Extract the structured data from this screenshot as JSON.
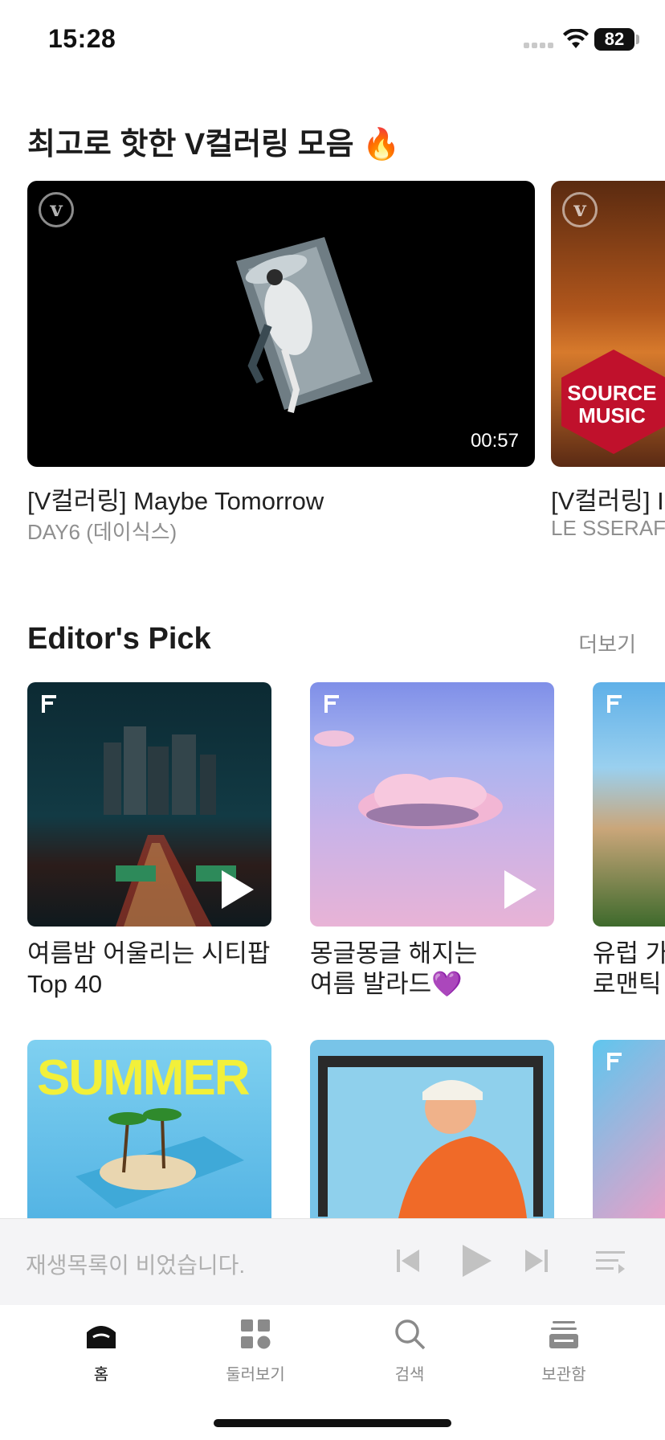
{
  "status_bar": {
    "time": "15:28",
    "battery": "82"
  },
  "vcoloring": {
    "title": "최고로 핫한 V컬러링 모음 🔥",
    "cards": [
      {
        "title": "[V컬러링] Maybe Tomorrow",
        "artist": "DAY6 (데이식스)",
        "duration": "00:57",
        "logo": "v"
      },
      {
        "title": "[V컬러링] I",
        "artist": "LE SSERAF",
        "logo": "v",
        "badge_text": "SOURCE MUSIC"
      }
    ]
  },
  "editors_pick": {
    "title": "Editor's Pick",
    "more": "더보기",
    "cards": [
      {
        "line1": "여름밤 어울리는 시티팝",
        "line2": "Top 40"
      },
      {
        "line1": "몽글몽글 해지는",
        "line2": "여름 발라드💜"
      },
      {
        "line1": "유럽 가",
        "line2": "로맨틱"
      }
    ],
    "row2": [
      {
        "cover_text": "SUMMER"
      },
      {
        "cover_text": ""
      },
      {
        "cover_text": ""
      }
    ]
  },
  "mini_player": {
    "status": "재생목록이 비었습니다."
  },
  "tab_bar": {
    "tabs": [
      {
        "label": "홈",
        "icon": "home-icon",
        "active": true
      },
      {
        "label": "둘러보기",
        "icon": "grid-icon",
        "active": false
      },
      {
        "label": "검색",
        "icon": "search-icon",
        "active": false
      },
      {
        "label": "보관함",
        "icon": "library-icon",
        "active": false
      }
    ]
  },
  "colors": {
    "accent": "#111111",
    "muted": "#8f8f8f",
    "player_bg": "#f4f4f6"
  }
}
